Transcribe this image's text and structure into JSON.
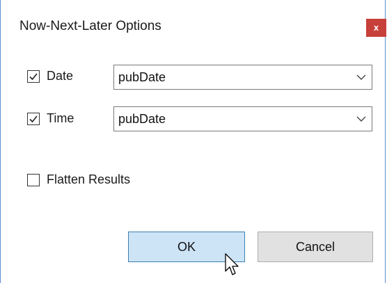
{
  "window": {
    "title": "Now-Next-Later Options",
    "close_label": "x"
  },
  "fields": [
    {
      "label": "Date",
      "checked": true,
      "value": "pubDate"
    },
    {
      "label": "Time",
      "checked": true,
      "value": "pubDate"
    }
  ],
  "flatten": {
    "label": "Flatten Results",
    "checked": false
  },
  "buttons": {
    "ok": "OK",
    "cancel": "Cancel"
  },
  "colors": {
    "close_bg": "#c7403a",
    "ok_bg": "#cde4f7",
    "ok_border": "#3c7fb1",
    "frame_border": "#5a8fd0"
  },
  "icons": {
    "check": "check-icon",
    "chevron": "chevron-down-icon",
    "cursor": "mouse-pointer-icon"
  }
}
